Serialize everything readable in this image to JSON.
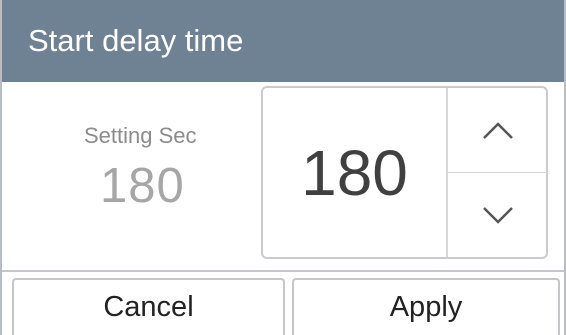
{
  "dialog": {
    "title": "Start delay time",
    "setting_label": "Setting Sec",
    "setting_value": "180",
    "stepper_value": "180",
    "cancel_label": "Cancel",
    "apply_label": "Apply"
  },
  "icons": {
    "increment": "chevron-up-icon",
    "decrement": "chevron-down-icon"
  },
  "colors": {
    "titlebar": "#6f8293",
    "setting_text": "#a6a6a6"
  }
}
